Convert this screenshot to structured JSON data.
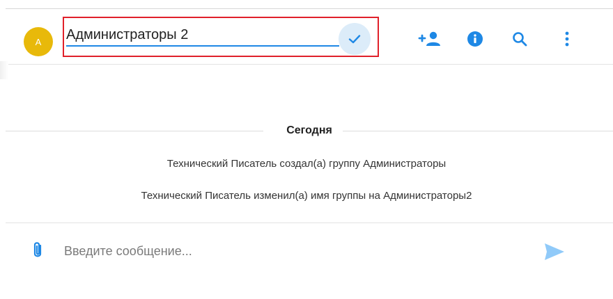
{
  "header": {
    "avatar_initial": "A",
    "group_name_value": "Администраторы 2",
    "icons": {
      "confirm": "checkmark-icon",
      "add_member": "add-person-icon",
      "info": "info-icon",
      "search": "search-icon",
      "more": "more-vertical-icon"
    }
  },
  "chat": {
    "date_divider": "Сегодня",
    "system_messages": [
      "Технический Писатель создал(а) группу Администраторы",
      "Технический Писатель изменил(а) имя группы на Администраторы2"
    ]
  },
  "composer": {
    "placeholder": "Введите сообщение...",
    "icons": {
      "attach": "paperclip-icon",
      "send": "send-icon"
    }
  },
  "colors": {
    "accent": "#1e88e5",
    "avatar_bg": "#e8b90a",
    "highlight_border": "#e0202a",
    "confirm_bg": "#dcecf9",
    "send_icon": "#90caf9"
  }
}
